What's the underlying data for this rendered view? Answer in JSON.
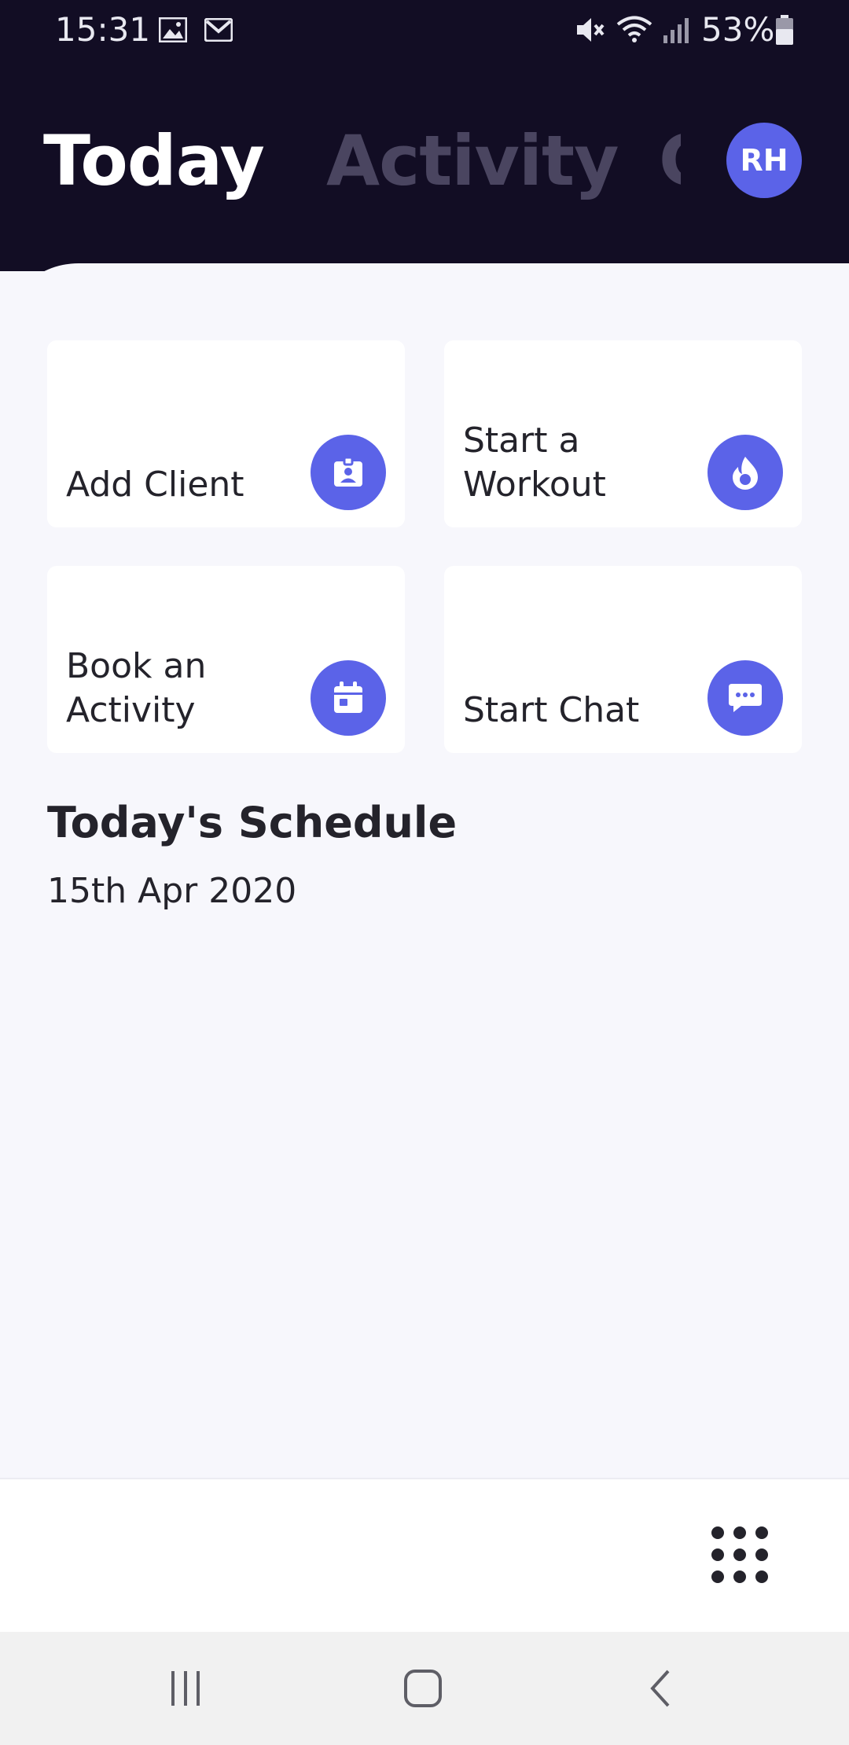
{
  "status_bar": {
    "time": "15:31",
    "battery": "53%",
    "icons": [
      "image-icon",
      "gmail-icon",
      "mute-icon",
      "wifi-icon",
      "signal-icon",
      "battery-icon"
    ]
  },
  "header": {
    "tabs": [
      {
        "label": "Today",
        "active": true
      },
      {
        "label": "Activity",
        "active": false
      },
      {
        "label": "C",
        "active": false
      }
    ],
    "avatar_initials": "RH"
  },
  "actions": [
    {
      "label": "Add Client",
      "icon": "id-badge-icon"
    },
    {
      "label": "Start a Workout",
      "icon": "flame-icon"
    },
    {
      "label": "Book an Activity",
      "icon": "calendar-icon"
    },
    {
      "label": "Start Chat",
      "icon": "chat-bubble-icon"
    }
  ],
  "schedule": {
    "title": "Today's Schedule",
    "date": "15th Apr 2020"
  },
  "bottom_bar": {
    "menu_icon": "grid-menu-icon"
  },
  "nav": {
    "buttons": [
      "recent-apps-icon",
      "home-icon",
      "back-icon"
    ]
  },
  "colors": {
    "header_bg": "#120d24",
    "accent": "#5b63e8",
    "sheet_bg": "#f7f7fc",
    "text_dark": "#24232b",
    "tab_inactive": "#4a4560"
  }
}
